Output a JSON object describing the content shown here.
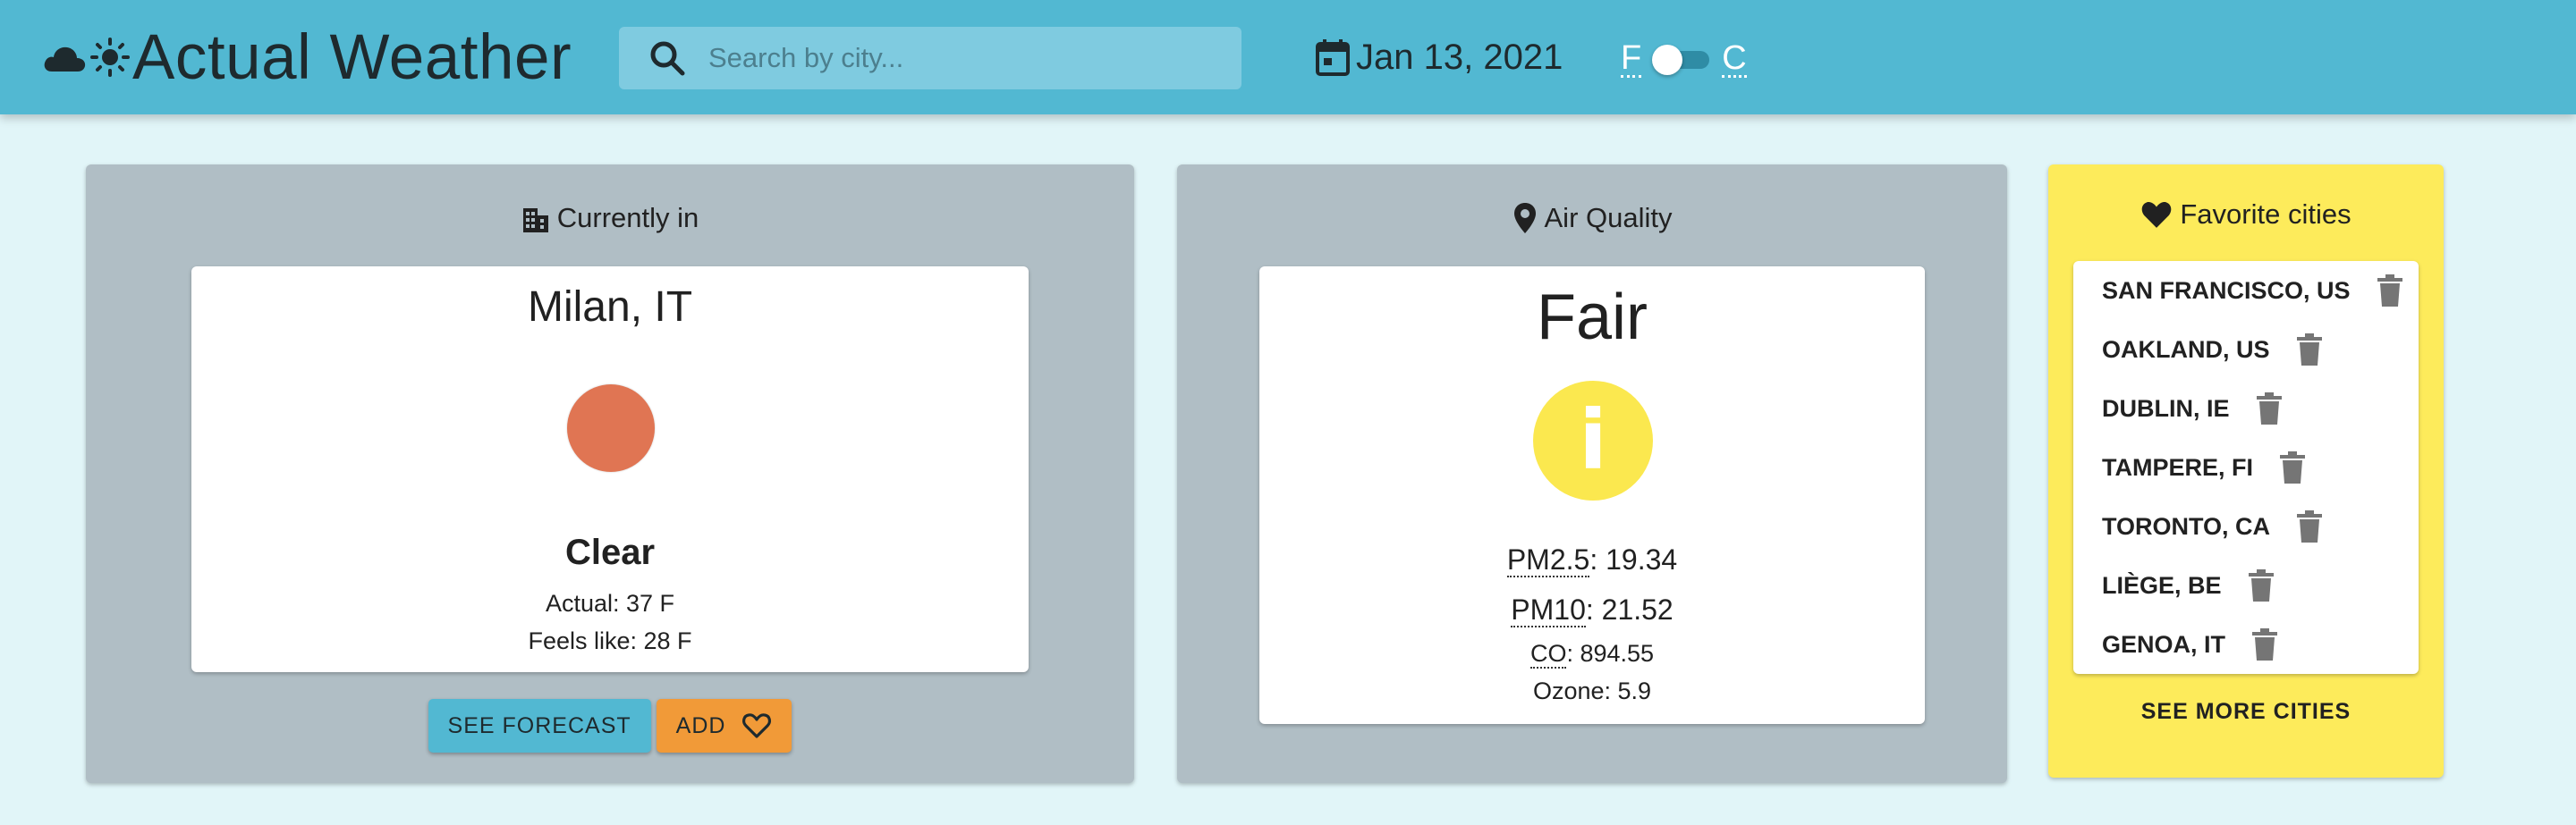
{
  "header": {
    "title": "Actual Weather",
    "search_placeholder": "Search by city...",
    "date": "Jan 13, 2021",
    "unit_f": "F",
    "unit_c": "C",
    "colors": {
      "bar": "#52b8d2",
      "background": "#e1f5f8"
    }
  },
  "current": {
    "heading": "Currently in",
    "city": "Milan, IT",
    "condition": "Clear",
    "actual": "Actual: 37 F",
    "feels_like": "Feels like: 28 F",
    "icon": "sun-icon",
    "see_forecast": "SEE FORECAST",
    "add": "ADD"
  },
  "air_quality": {
    "heading": "Air Quality",
    "level": "Fair",
    "icon": "info-icon",
    "pm25_label": "PM2.5",
    "pm25_value": ": 19.34",
    "pm10_label": "PM10",
    "pm10_value": ": 21.52",
    "co_label": "CO",
    "co_value": ": 894.55",
    "ozone": "Ozone: 5.9"
  },
  "favorites": {
    "heading": "Favorite cities",
    "cities": [
      "SAN FRANCISCO, US",
      "OAKLAND, US",
      "DUBLIN, IE",
      "TAMPERE, FI",
      "TORONTO, CA",
      "LIÈGE, BE",
      "GENOA, IT"
    ],
    "see_more": "SEE MORE CITIES"
  }
}
